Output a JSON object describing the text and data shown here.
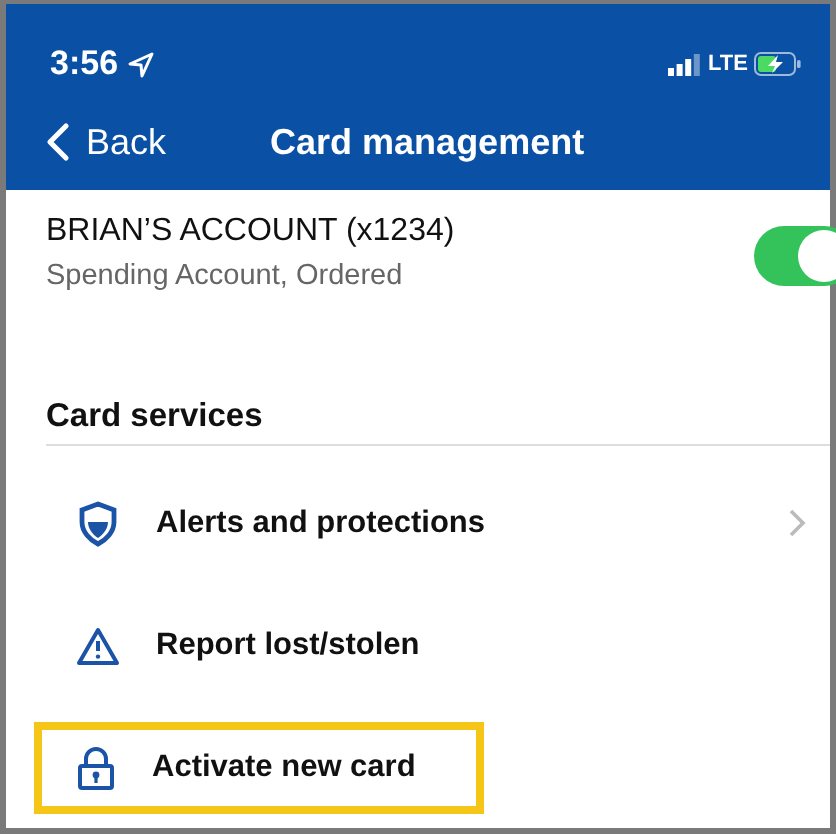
{
  "status_bar": {
    "time": "3:56",
    "network": "LTE"
  },
  "nav": {
    "back": "Back",
    "title": "Card management"
  },
  "account": {
    "name": "BRIAN’S ACCOUNT (x1234)",
    "detail": "Spending Account, Ordered",
    "on": true
  },
  "section": {
    "title": "Card services"
  },
  "items": [
    {
      "kind": "shield",
      "label": "Alerts and protections",
      "chevron": true,
      "highlighted": false
    },
    {
      "kind": "warning",
      "label": "Report lost/stolen",
      "chevron": false,
      "highlighted": false
    },
    {
      "kind": "lock",
      "label": "Activate new card",
      "chevron": false,
      "highlighted": true
    }
  ]
}
